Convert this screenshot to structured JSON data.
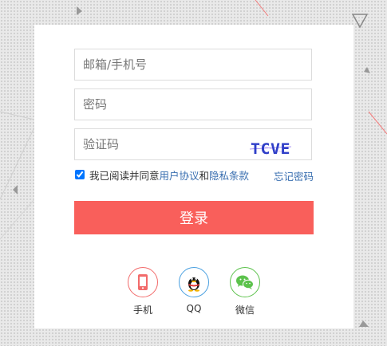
{
  "form": {
    "email_placeholder": "邮箱/手机号",
    "password_placeholder": "密码",
    "captcha_placeholder": "验证码",
    "captcha_text": "TCVE"
  },
  "agreement": {
    "checked": true,
    "prefix": "我已阅读并同意",
    "user_agreement": "用户协议",
    "and": "和",
    "privacy_terms": "隐私条款"
  },
  "forgot_password": "忘记密码",
  "login_label": "登录",
  "social": [
    {
      "label": "手机",
      "icon": "phone-icon",
      "color": "#f26b6b"
    },
    {
      "label": "QQ",
      "icon": "qq-icon",
      "color": "#4aa0e0"
    },
    {
      "label": "微信",
      "icon": "wechat-icon",
      "color": "#5cc24c"
    }
  ],
  "colors": {
    "accent": "#f95f5b",
    "link": "#3a6fb0",
    "background": "#e9e9e9"
  }
}
